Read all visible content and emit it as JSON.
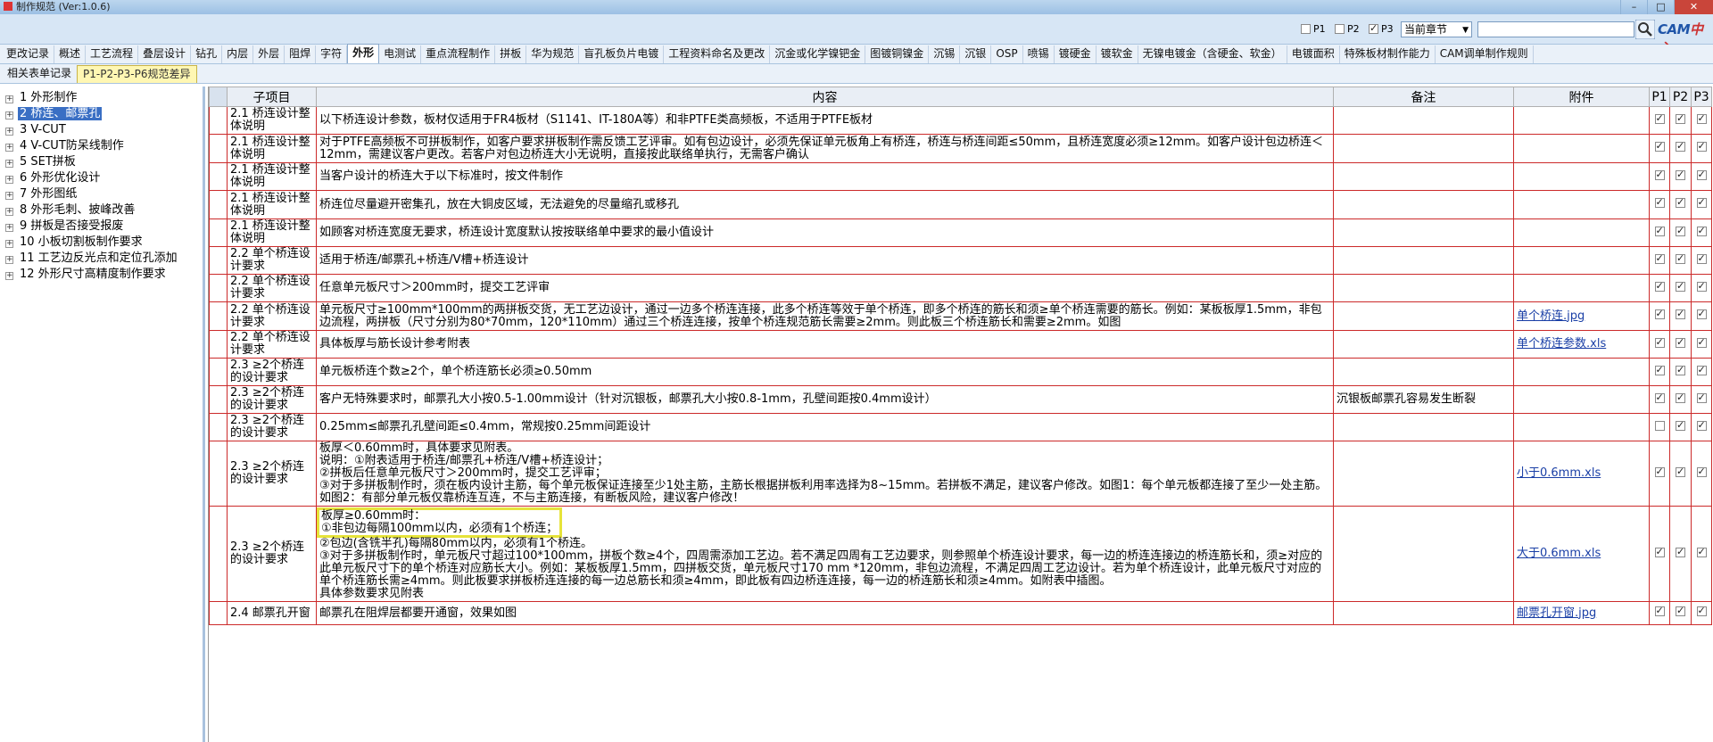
{
  "window": {
    "title": "制作规范 (Ver:1.0.6)"
  },
  "toolbar": {
    "filters": [
      {
        "label": "P1",
        "checked": false
      },
      {
        "label": "P2",
        "checked": false
      },
      {
        "label": "P3",
        "checked": true
      }
    ],
    "scope_select": "当前章节",
    "search_value": "",
    "logo_a": "CAM",
    "logo_b": "中心"
  },
  "tabs": [
    "更改记录",
    "概述",
    "工艺流程",
    "叠层设计",
    "钻孔",
    "内层",
    "外层",
    "阻焊",
    "字符",
    "外形",
    "电测试",
    "重点流程制作",
    "拼板",
    "华为规范",
    "盲孔板负片电镀",
    "工程资料命名及更改",
    "沉金或化学镍钯金",
    "图镀铜镍金",
    "沉锡",
    "沉银",
    "OSP",
    "喷锡",
    "镀硬金",
    "镀软金",
    "无镍电镀金（含硬金、软金）",
    "电镀面积",
    "特殊板材制作能力",
    "CAM调单制作规则"
  ],
  "active_tab": "外形",
  "subtabs": [
    "相关表单记录",
    "P1-P2-P3-P6规范差异"
  ],
  "active_subtab": "P1-P2-P3-P6规范差异",
  "tree": [
    "1 外形制作",
    "2 桥连、邮票孔",
    "3 V-CUT",
    "4 V-CUT防呆线制作",
    "5 SET拼板",
    "6 外形优化设计",
    "7 外形图纸",
    "8 外形毛刺、披峰改善",
    "9 拼板是否接受报废",
    "10 小板切割板制作要求",
    "11 工艺边反光点和定位孔添加",
    "12 外形尺寸高精度制作要求"
  ],
  "tree_selected": 1,
  "table": {
    "headers": [
      "子项目",
      "内容",
      "备注",
      "附件",
      "P1",
      "P2",
      "P3"
    ],
    "rows": [
      {
        "sub": "2.1 桥连设计整体说明",
        "content": [
          "以下桥连设计参数，板材仅适用于FR4板材（S1141、IT-180A等）和非PTFE类高频板，不适用于PTFE板材"
        ],
        "note": "",
        "attach": "",
        "p": [
          true,
          true,
          true
        ]
      },
      {
        "sub": "2.1 桥连设计整体说明",
        "content": [
          "对于PTFE高频板不可拼板制作，如客户要求拼板制作需反馈工艺评审。如有包边设计，必须先保证单元板角上有桥连，桥连与桥连间距≤50mm，且桥连宽度必须≥12mm。如客户设计包边桥连＜12mm，需建议客户更改。若客户对包边桥连大小无说明，直接按此联络单执行，无需客户确认"
        ],
        "note": "",
        "attach": "",
        "p": [
          true,
          true,
          true
        ]
      },
      {
        "sub": "2.1 桥连设计整体说明",
        "content": [
          "当客户设计的桥连大于以下标准时，按文件制作"
        ],
        "note": "",
        "attach": "",
        "p": [
          true,
          true,
          true
        ]
      },
      {
        "sub": "2.1 桥连设计整体说明",
        "content": [
          "桥连位尽量避开密集孔，放在大铜皮区域，无法避免的尽量缩孔或移孔"
        ],
        "note": "",
        "attach": "",
        "p": [
          true,
          true,
          true
        ]
      },
      {
        "sub": "2.1 桥连设计整体说明",
        "content": [
          "如顾客对桥连宽度无要求，桥连设计宽度默认按按联络单中要求的最小值设计"
        ],
        "note": "",
        "attach": "",
        "p": [
          true,
          true,
          true
        ]
      },
      {
        "sub": "2.2 单个桥连设计要求",
        "content": [
          "适用于桥连/邮票孔+桥连/V槽+桥连设计"
        ],
        "note": "",
        "attach": "",
        "p": [
          true,
          true,
          true
        ]
      },
      {
        "sub": "2.2 单个桥连设计要求",
        "content": [
          "任意单元板尺寸＞200mm时，提交工艺评审"
        ],
        "note": "",
        "attach": "",
        "p": [
          true,
          true,
          true
        ]
      },
      {
        "sub": "2.2 单个桥连设计要求",
        "content": [
          "单元板尺寸≥100mm*100mm的两拼板交货，无工艺边设计，通过一边多个桥连连接，此多个桥连等效于单个桥连，即多个桥连的筋长和须≥单个桥连需要的筋长。例如：某板板厚1.5mm，非包边流程，两拼板（尺寸分别为80*70mm，120*110mm）通过三个桥连连接，按单个桥连规范筋长需要≥2mm。则此板三个桥连筋长和需要≥2mm。如图"
        ],
        "note": "",
        "attach": "单个桥连.jpg",
        "p": [
          true,
          true,
          true
        ]
      },
      {
        "sub": "2.2 单个桥连设计要求",
        "content": [
          "具体板厚与筋长设计参考附表"
        ],
        "note": "",
        "attach": "单个桥连参数.xls",
        "p": [
          true,
          true,
          true
        ]
      },
      {
        "sub": "2.3 ≥2个桥连的设计要求",
        "content": [
          "单元板桥连个数≥2个，单个桥连筋长必须≥0.50mm"
        ],
        "note": "",
        "attach": "",
        "p": [
          true,
          true,
          true
        ]
      },
      {
        "sub": "2.3 ≥2个桥连的设计要求",
        "content": [
          "客户无特殊要求时，邮票孔大小按0.5-1.00mm设计（针对沉银板，邮票孔大小按0.8-1mm，孔壁间距按0.4mm设计）"
        ],
        "note": "沉银板邮票孔容易发生断裂",
        "attach": "",
        "p": [
          true,
          true,
          true
        ]
      },
      {
        "sub": "2.3 ≥2个桥连的设计要求",
        "content": [
          "0.25mm≤邮票孔孔壁间距≤0.4mm，常规按0.25mm间距设计"
        ],
        "note": "",
        "attach": "",
        "p": [
          false,
          true,
          true
        ]
      },
      {
        "sub": "2.3 ≥2个桥连的设计要求",
        "content": [
          "板厚＜0.60mm时，具体要求见附表。",
          "说明：①附表适用于桥连/邮票孔+桥连/V槽+桥连设计；",
          "②拼板后任意单元板尺寸＞200mm时，提交工艺评审；",
          "③对于多拼板制作时，须在板内设计主筋，每个单元板保证连接至少1处主筋，主筋长根据拼板利用率选择为8~15mm。若拼板不满足，建议客户修改。如图1：每个单元板都连接了至少一处主筋。如图2：有部分单元板仅靠桥连互连，不与主筋连接，有断板风险，建议客户修改！"
        ],
        "note": "",
        "attach": "小于0.6mm.xls",
        "p": [
          true,
          true,
          true
        ]
      },
      {
        "sub": "2.3 ≥2个桥连的设计要求",
        "content": [
          "板厚≥0.60mm时：",
          "①非包边每隔100mm以内，必须有1个桥连；",
          "②包边(含铣半孔)每隔80mm以内，必须有1个桥连。",
          "③对于多拼板制作时，单元板尺寸超过100*100mm，拼板个数≥4个，四周需添加工艺边。若不满足四周有工艺边要求，则参照单个桥连设计要求，每一边的桥连连接边的桥连筋长和，须≥对应的此单元板尺寸下的单个桥连对应筋长大小。例如：某板板厚1.5mm，四拼板交货，单元板尺寸170 mm *120mm，非包边流程，不满足四周工艺边设计。若为单个桥连设计，此单元板尺寸对应的单个桥连筋长需≥4mm。则此板要求拼板桥连连接的每一边总筋长和须≥4mm，即此板有四边桥连连接，每一边的桥连筋长和须≥4mm。如附表中插图。",
          "具体参数要求见附表"
        ],
        "note": "",
        "attach": "大于0.6mm.xls",
        "p": [
          true,
          true,
          true
        ],
        "highlight": [
          0,
          1
        ]
      },
      {
        "sub": "2.4 邮票孔开窗",
        "content": [
          "邮票孔在阻焊层都要开通窗，效果如图"
        ],
        "note": "",
        "attach": "邮票孔开窗.jpg",
        "p": [
          true,
          true,
          true
        ]
      }
    ]
  }
}
